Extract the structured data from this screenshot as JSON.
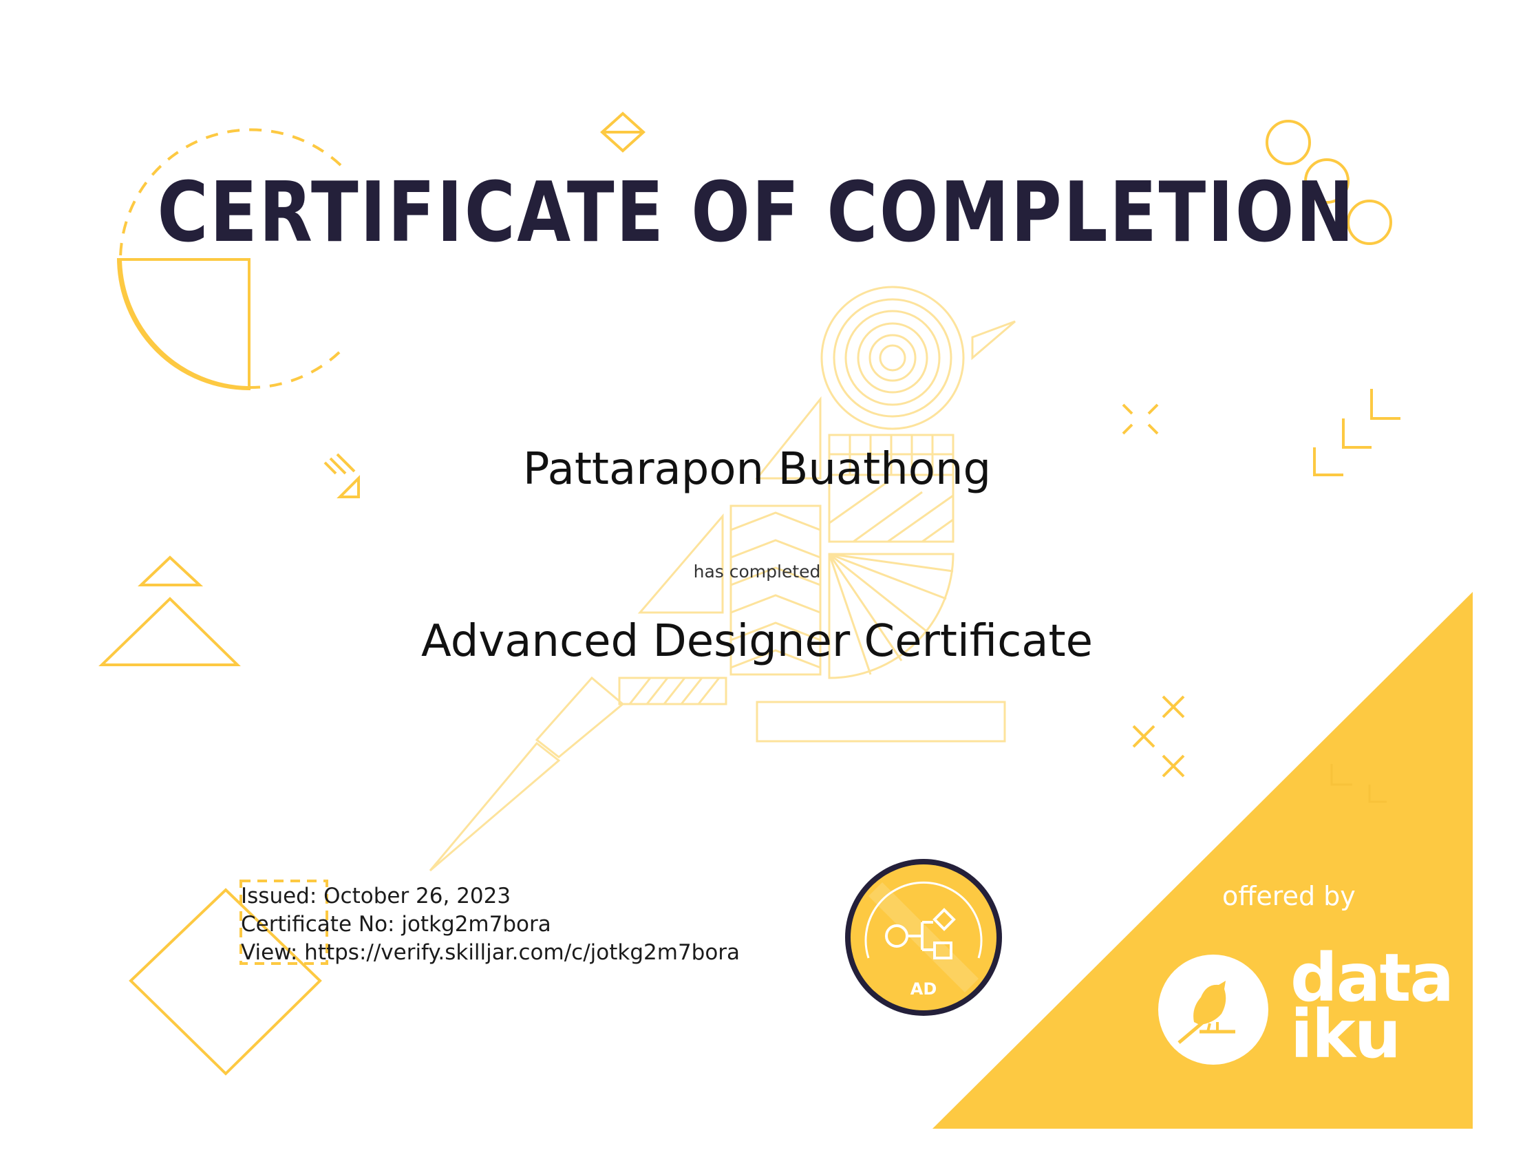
{
  "certificate": {
    "title": "CERTIFICATE OF COMPLETION",
    "recipient": "Pattarapon Buathong",
    "has_completed": "has completed",
    "course": "Advanced Designer Certificate",
    "issued": "Issued: October 26, 2023",
    "certificate_no": "Certificate No: jotkg2m7bora",
    "view": "View: https://verify.skilljar.com/c/jotkg2m7bora"
  },
  "badge": {
    "label": "AD"
  },
  "provider": {
    "offered_by": "offered by",
    "logo_line1": "data",
    "logo_line2": "iku"
  },
  "colors": {
    "accent": "#fdc942",
    "title": "#24203a",
    "badge_ring": "#24203a"
  }
}
